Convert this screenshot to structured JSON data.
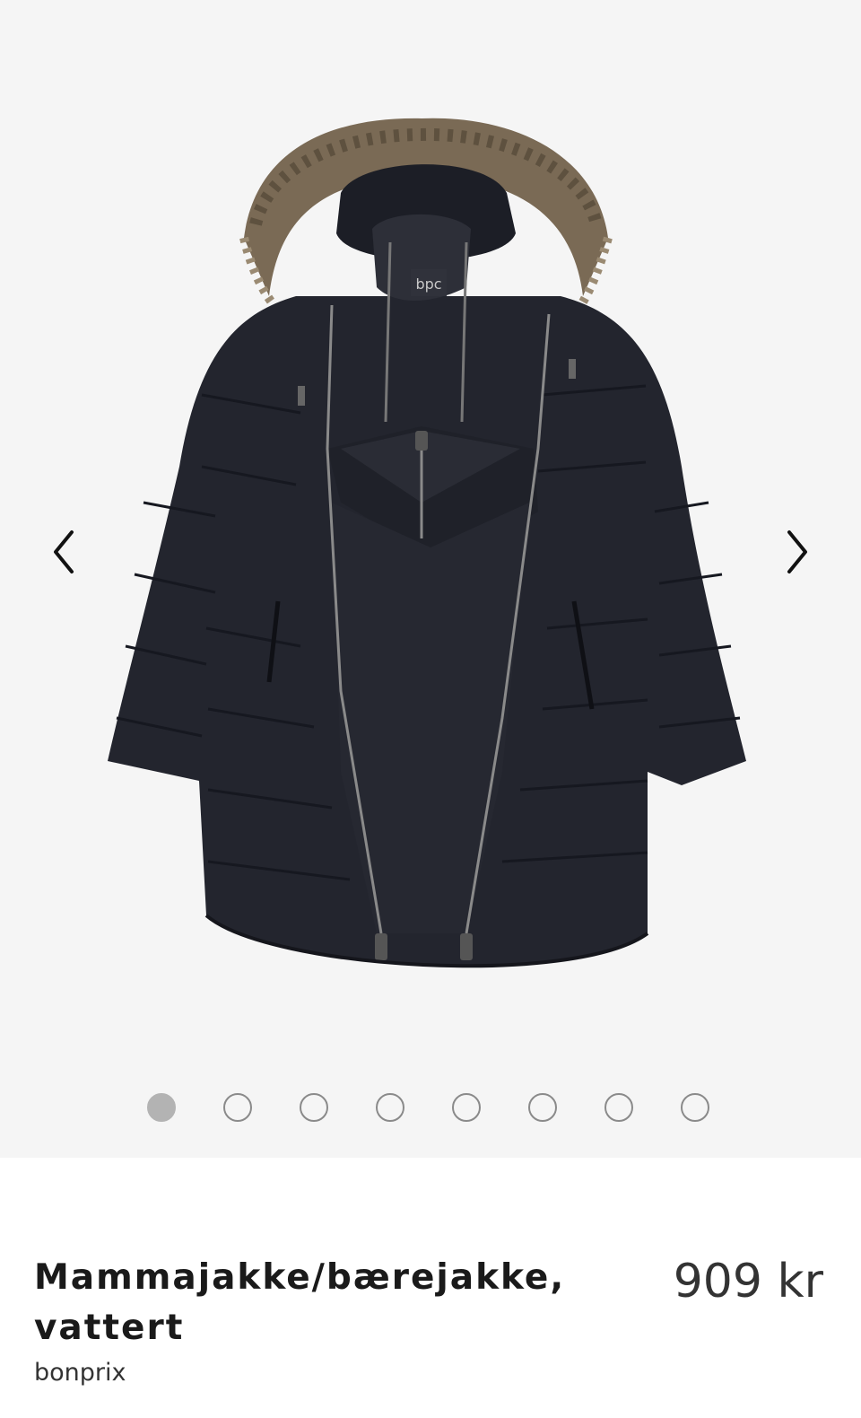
{
  "product": {
    "title_line1": "Mammajakke/bærejakke,",
    "title_line2": "vattert",
    "price": "909 kr",
    "brand": "bonprix"
  },
  "gallery": {
    "image_count": 8,
    "active_index": 0,
    "image_label": "bpc",
    "prev_icon": "chevron-left-icon",
    "next_icon": "chevron-right-icon"
  },
  "colors": {
    "gallery_bg": "#f5f5f5",
    "jacket": "#23252e",
    "fur": "#7a6a55",
    "dot_active": "#b3b3b3",
    "dot_border": "#8a8a8a"
  }
}
